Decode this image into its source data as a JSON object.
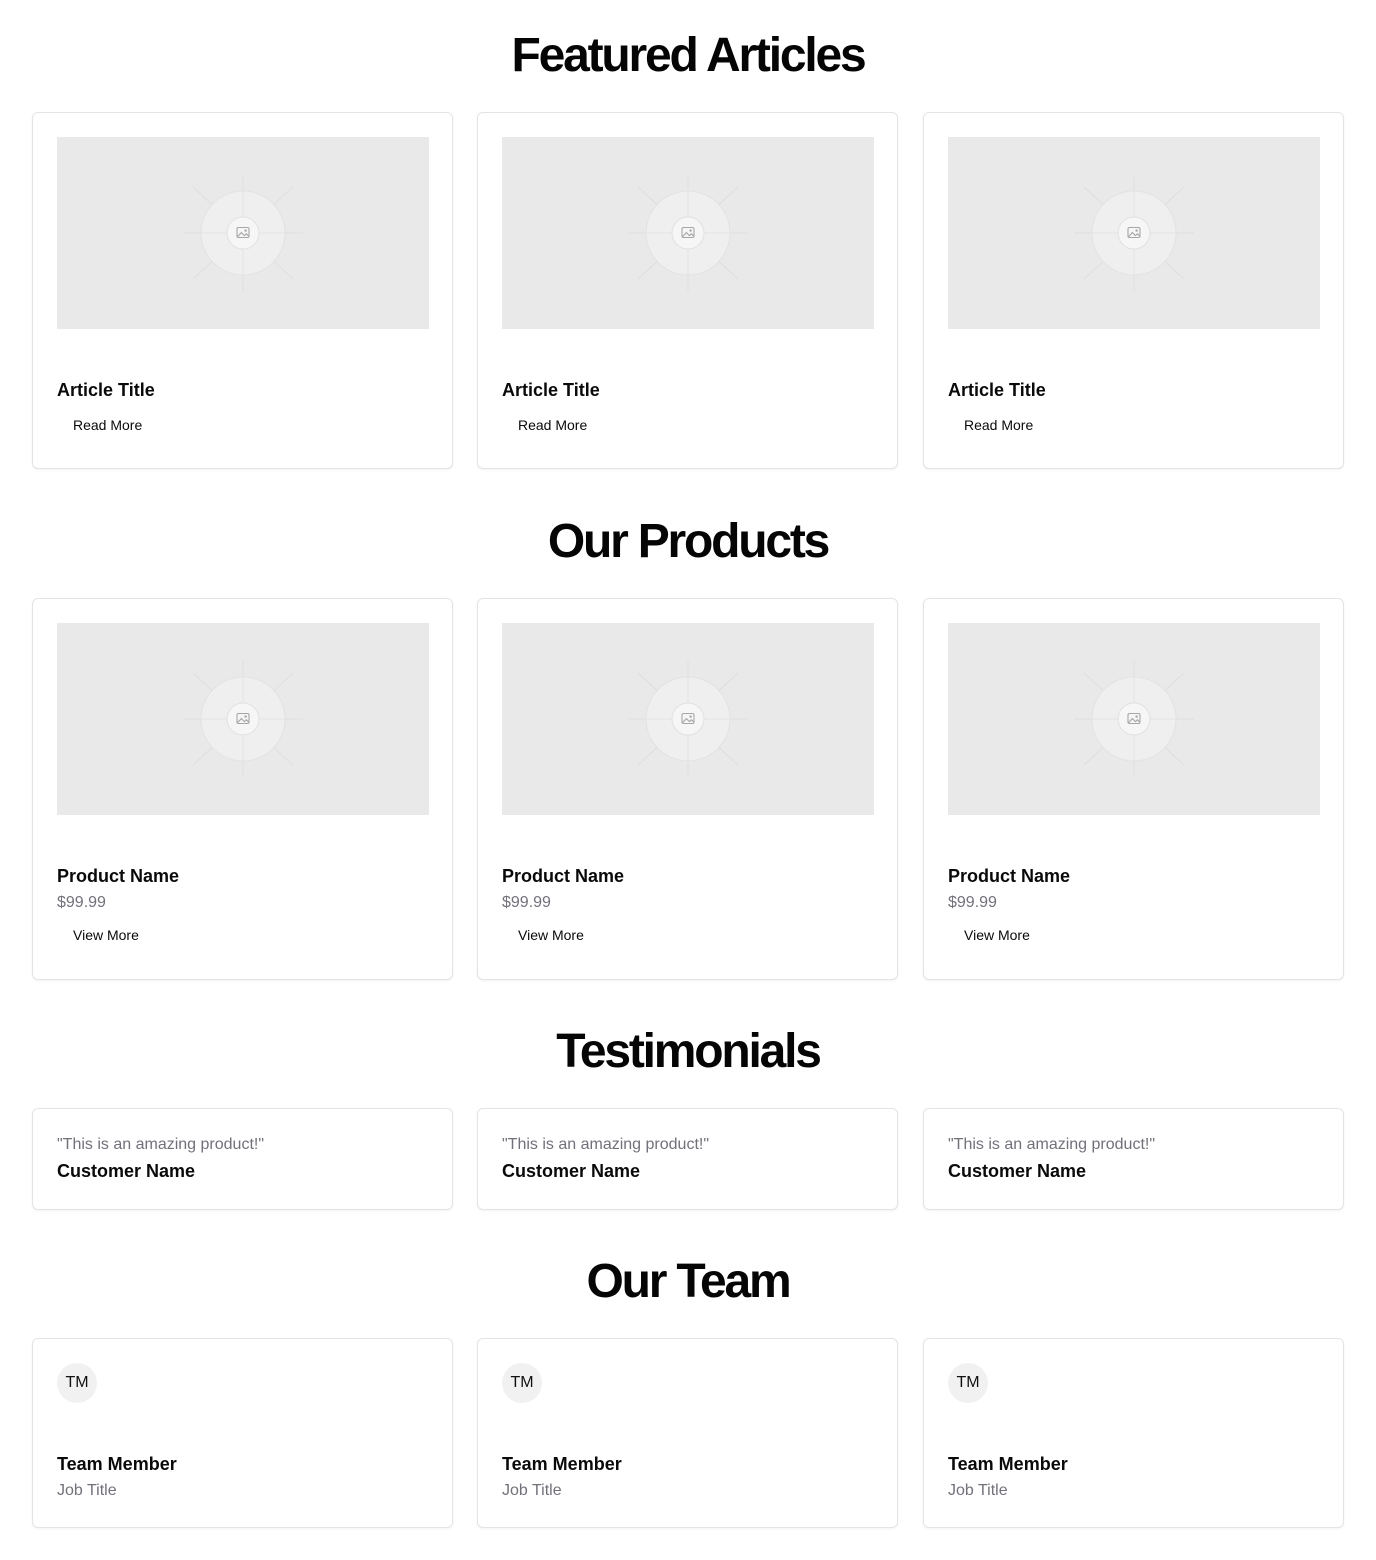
{
  "articles": {
    "title": "Featured Articles",
    "items": [
      {
        "title": "Article Title",
        "button": "Read More",
        "image_icon": "image-icon"
      },
      {
        "title": "Article Title",
        "button": "Read More",
        "image_icon": "image-icon"
      },
      {
        "title": "Article Title",
        "button": "Read More",
        "image_icon": "image-icon"
      }
    ]
  },
  "products": {
    "title": "Our Products",
    "items": [
      {
        "name": "Product Name",
        "price": "$99.99",
        "button": "View More",
        "image_icon": "image-icon"
      },
      {
        "name": "Product Name",
        "price": "$99.99",
        "button": "View More",
        "image_icon": "image-icon"
      },
      {
        "name": "Product Name",
        "price": "$99.99",
        "button": "View More",
        "image_icon": "image-icon"
      }
    ]
  },
  "testimonials": {
    "title": "Testimonials",
    "items": [
      {
        "quote": "\"This is an amazing product!\"",
        "customer": "Customer Name"
      },
      {
        "quote": "\"This is an amazing product!\"",
        "customer": "Customer Name"
      },
      {
        "quote": "\"This is an amazing product!\"",
        "customer": "Customer Name"
      }
    ]
  },
  "team": {
    "title": "Our Team",
    "items": [
      {
        "initials": "TM",
        "name": "Team Member",
        "job": "Job Title"
      },
      {
        "initials": "TM",
        "name": "Team Member",
        "job": "Job Title"
      },
      {
        "initials": "TM",
        "name": "Team Member",
        "job": "Job Title"
      }
    ]
  },
  "colors": {
    "heading": "#050505",
    "muted_text": "#71717a",
    "card_border": "#e4e4e7",
    "placeholder_bg": "#e9e9e9",
    "avatar_bg": "#f1f1f2"
  }
}
